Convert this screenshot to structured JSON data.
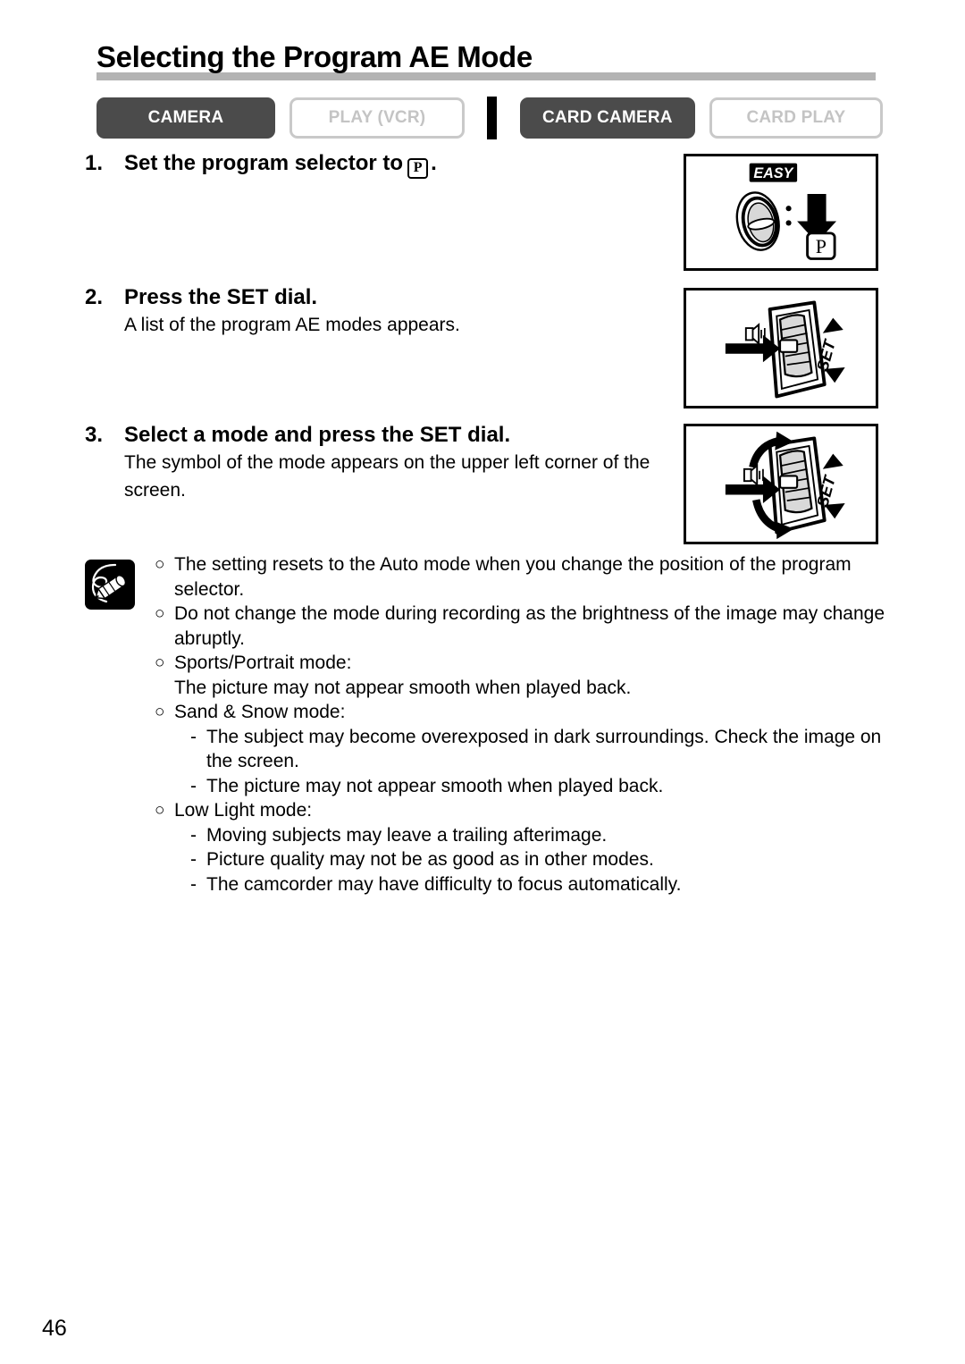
{
  "page": {
    "title": "Selecting the Program AE Mode",
    "number": "46"
  },
  "mode_bar": {
    "buttons": [
      {
        "label": "CAMERA",
        "state": "active"
      },
      {
        "label": "PLAY (VCR)",
        "state": "inactive"
      },
      {
        "label": "CARD CAMERA",
        "state": "active"
      },
      {
        "label": "CARD PLAY",
        "state": "inactive"
      }
    ],
    "separator": "|"
  },
  "steps": [
    {
      "number": "1.",
      "title_before": "Set the program selector to",
      "symbol": "P",
      "title_after": ".",
      "body": ""
    },
    {
      "number": "2.",
      "title": "Press the SET dial.",
      "body": "A list of the program AE modes appears."
    },
    {
      "number": "3.",
      "title": "Select a mode and press the SET dial.",
      "body": "The symbol of the mode appears on the upper left corner of the screen."
    }
  ],
  "illustrations": [
    {
      "name": "program-selector-dial",
      "labels": [
        "EASY",
        "P"
      ]
    },
    {
      "name": "set-dial-press",
      "labels": [
        "SET"
      ]
    },
    {
      "name": "set-dial-rotate-press",
      "labels": [
        "SET"
      ]
    }
  ],
  "notes": {
    "icon": "memo-pencil-icon",
    "items": [
      {
        "bullet": "⭕",
        "text": "The setting resets to the Auto mode when you change the position of the program selector.",
        "sub": []
      },
      {
        "bullet": "⭕",
        "text": "Do not change the mode during recording as the brightness of the image may change abruptly.",
        "sub": []
      },
      {
        "bullet": "⭕",
        "text": "Sports/Portrait mode:",
        "plain": "The picture may not appear smooth when played back.",
        "sub": []
      },
      {
        "bullet": "⭕",
        "text": "Sand & Snow mode:",
        "sub": [
          "The subject may become overexposed in dark surroundings. Check the image on the screen.",
          "The picture may not appear smooth when played back."
        ]
      },
      {
        "bullet": "⭕",
        "text": "Low Light mode:",
        "sub": [
          "Moving subjects may leave a trailing afterimage.",
          "Picture quality may not be as good as in other modes.",
          "The camcorder may have difficulty to focus automatically."
        ]
      }
    ],
    "dash": "-"
  },
  "colors": {
    "active_button_bg": "#4b4b4b",
    "inactive_button_border": "#c9c9c9",
    "inactive_button_text": "#c4c4c4",
    "title_rule": "#b3b3b3",
    "text": "#000000"
  }
}
